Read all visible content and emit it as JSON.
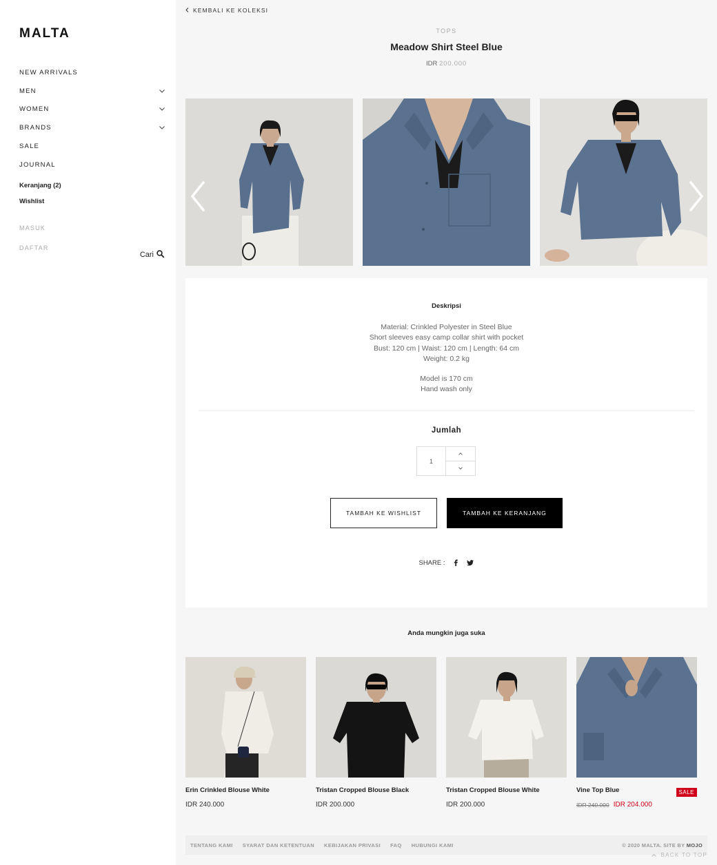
{
  "sidebar": {
    "logo": "MALTA",
    "nav": [
      {
        "label": "NEW ARRIVALS",
        "has_dropdown": false
      },
      {
        "label": "MEN",
        "has_dropdown": true
      },
      {
        "label": "WOMEN",
        "has_dropdown": true
      },
      {
        "label": "BRANDS",
        "has_dropdown": true
      },
      {
        "label": "SALE",
        "has_dropdown": false
      },
      {
        "label": "JOURNAL",
        "has_dropdown": false
      }
    ],
    "cart_label": "Keranjang (2)",
    "wishlist_label": "Wishlist",
    "login_label": "MASUK",
    "register_label": "DAFTAR",
    "search_label": "Cari",
    "search_icon": "search-icon"
  },
  "product": {
    "back_label": "KEMBALI KE KOLEKSI",
    "category": "TOPS",
    "title": "Meadow Shirt Steel Blue",
    "currency": "IDR",
    "price": "200.000",
    "gallery_count": 3,
    "description_title": "Deskripsi",
    "description_lines": [
      "Material: Crinkled Polyester in Steel Blue",
      "Short sleeves easy camp collar shirt with pocket",
      "Bust: 120 cm | Waist: 120 cm | Length: 64 cm",
      "Weight: 0.2 kg"
    ],
    "description_notes": [
      "Model is 170 cm",
      "Hand wash only"
    ],
    "quantity_label": "Jumlah",
    "quantity": "1",
    "wishlist_button": "TAMBAH KE WISHLIST",
    "cart_button": "TAMBAH KE KERANJANG",
    "share_label": "SHARE :",
    "share_icons": [
      "facebook-icon",
      "twitter-icon"
    ]
  },
  "recommendations": {
    "title": "Anda mungkin juga suka",
    "items": [
      {
        "name": "Erin Crinkled Blouse White",
        "price": "IDR 240.000",
        "old_price": "",
        "sale": ""
      },
      {
        "name": "Tristan Cropped Blouse Black",
        "price": "IDR 200.000",
        "old_price": "",
        "sale": ""
      },
      {
        "name": "Tristan Cropped Blouse White",
        "price": "IDR 200.000",
        "old_price": "",
        "sale": ""
      },
      {
        "name": "Vine Top Blue",
        "price": "IDR 204.000",
        "old_price": "IDR 240.000",
        "sale": "SALE"
      }
    ]
  },
  "footer": {
    "links": [
      "TENTANG KAMI",
      "SYARAT DAN KETENTUAN",
      "KEBIJAKAN PRIVASI",
      "FAQ",
      "HUBUNGI KAMI"
    ],
    "copyright": "© 2020 MALTA. SITE BY",
    "site_by": "MOJO",
    "back_to_top": "BACK TO TOP"
  },
  "colors": {
    "accent": "#000000",
    "sale": "#d0021b",
    "shirt_blue": "#5b7391",
    "background": "#f6f6f6"
  }
}
